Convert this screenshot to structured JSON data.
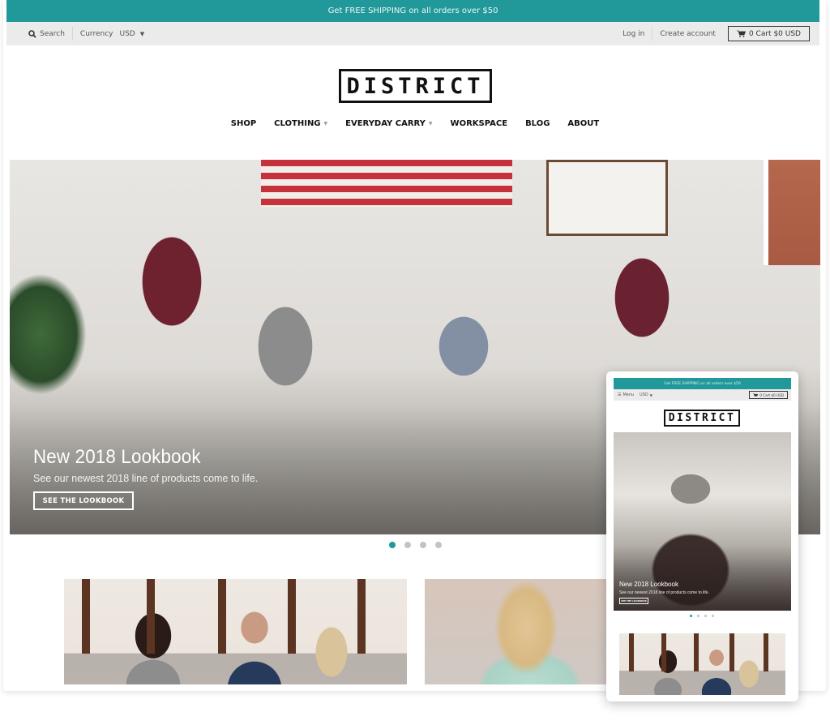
{
  "announcement": "Get FREE SHIPPING on all orders over $50",
  "utility": {
    "search_label": "Search",
    "currency_label": "Currency",
    "currency_value": "USD",
    "login_label": "Log in",
    "create_account_label": "Create account",
    "cart_label": "0 Cart $0 USD"
  },
  "logo_text": "DISTRICT",
  "nav": [
    {
      "label": "SHOP",
      "has_dropdown": false
    },
    {
      "label": "CLOTHING",
      "has_dropdown": true
    },
    {
      "label": "EVERYDAY CARRY",
      "has_dropdown": true
    },
    {
      "label": "WORKSPACE",
      "has_dropdown": false
    },
    {
      "label": "BLOG",
      "has_dropdown": false
    },
    {
      "label": "ABOUT",
      "has_dropdown": false
    }
  ],
  "hero": {
    "title": "New 2018 Lookbook",
    "subtitle": "See our newest 2018 line of products come to life.",
    "button_label": "SEE THE LOOKBOOK",
    "slide_count": 4,
    "active_slide": 1
  },
  "mobile_preview": {
    "announcement": "Get FREE SHIPPING on all orders over $50",
    "menu_label": "Menu",
    "currency_value": "USD",
    "cart_label": "0 Cart $0 USD",
    "logo_text": "DISTRICT",
    "hero_title": "New 2018 Lookbook",
    "hero_subtitle": "See our newest 2018 line of products come to life.",
    "hero_button_label": "SEE THE LOOKBOOK"
  },
  "colors": {
    "accent": "#21999a",
    "utility_bar": "#ebebeb",
    "dot_inactive": "#c3c3c3"
  }
}
